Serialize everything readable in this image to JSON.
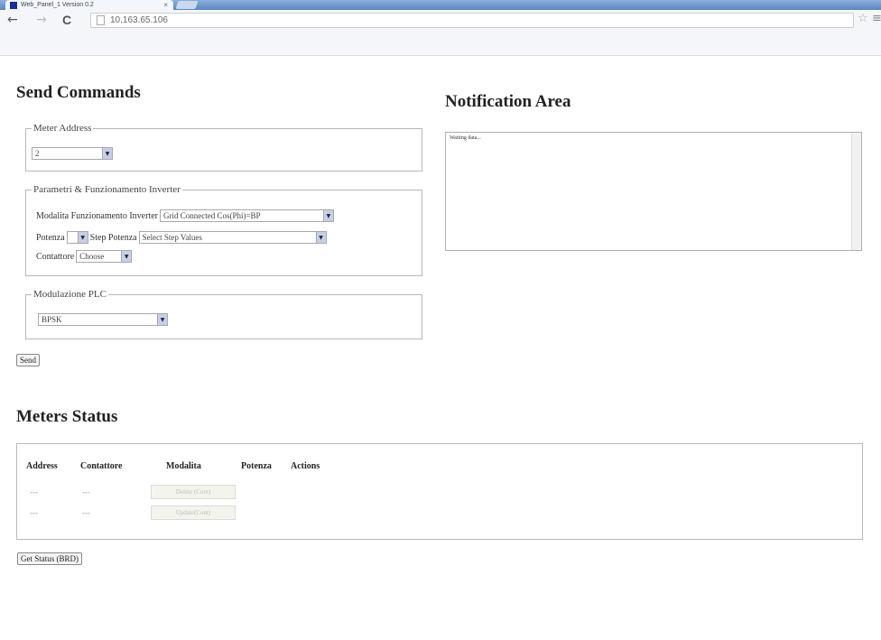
{
  "browser": {
    "tab_title": "Web_Panel_1 Version 0.2",
    "tab_close": "×",
    "url": "10.163.65.106",
    "back": "←",
    "forward": "→",
    "reload": "C",
    "star": "☆",
    "menu": "≡"
  },
  "send_commands": {
    "title": "Send Commands",
    "meter_address": {
      "legend": "Meter Address",
      "value": "2"
    },
    "inverter": {
      "legend": "Parametri & Funzionamento Inverter",
      "mode_label": "Modalita Funzionamento Inverter",
      "mode_value": "Grid Connected Cos(Phi)=BP",
      "power_label": "Potenza",
      "power_value": "",
      "step_label": "Step Potenza",
      "step_value": "Select Step Values",
      "contactor_label": "Contattore",
      "contactor_value": "Choose"
    },
    "plc": {
      "legend": "Modulazione PLC",
      "value": "BPSK"
    },
    "send_button": "Send"
  },
  "notification": {
    "title": "Notification Area",
    "text": "Waiting data..."
  },
  "meters_status": {
    "title": "Meters Status",
    "columns": [
      "Address",
      "Contattore",
      "Modalita",
      "Potenza",
      "Actions"
    ],
    "rows": [
      {
        "address": "---",
        "contactor": "---",
        "mode": "Delete (Cont)"
      },
      {
        "address": "---",
        "contactor": "---",
        "mode": "Update(Cont)"
      }
    ],
    "get_status_button": "Get Status (BRD)"
  }
}
